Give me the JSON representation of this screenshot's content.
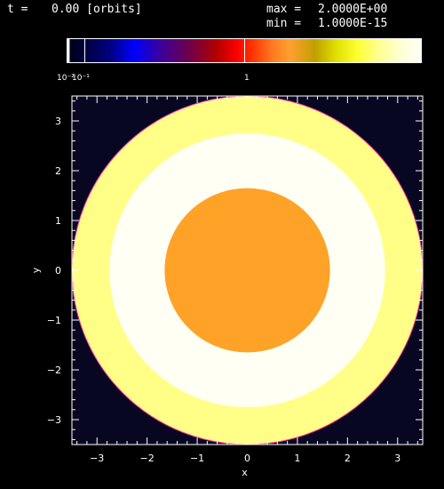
{
  "header": {
    "time_label": "t =",
    "time_value": "0.00 [orbits]",
    "max_label": "max =",
    "max_value": "2.0000E+00",
    "min_label": "min =",
    "min_value": "1.0000E-15"
  },
  "colorbar": {
    "tick_labels": [
      "10⁻²",
      "10⁻¹",
      "1"
    ]
  },
  "chart_data": {
    "type": "heatmap",
    "title": "",
    "xlabel": "x",
    "ylabel": "y",
    "xlim": [
      -3.5,
      3.5
    ],
    "ylim": [
      -3.5,
      3.5
    ],
    "xticks": [
      -3,
      -2,
      -1,
      0,
      1,
      2,
      3
    ],
    "yticks": [
      -3,
      -2,
      -1,
      0,
      1,
      2,
      3
    ],
    "background_color": "#070722",
    "regions": [
      {
        "shape": "disk",
        "r_outer": 3.5,
        "r_inner": 2.75,
        "color": "#ffff88"
      },
      {
        "shape": "disk",
        "r_outer": 2.75,
        "r_inner": 1.65,
        "color": "#fffff4"
      },
      {
        "shape": "disk",
        "r_outer": 1.65,
        "r_inner": 0,
        "color": "#ffa228"
      }
    ],
    "edge_color": "#ff30a0"
  }
}
